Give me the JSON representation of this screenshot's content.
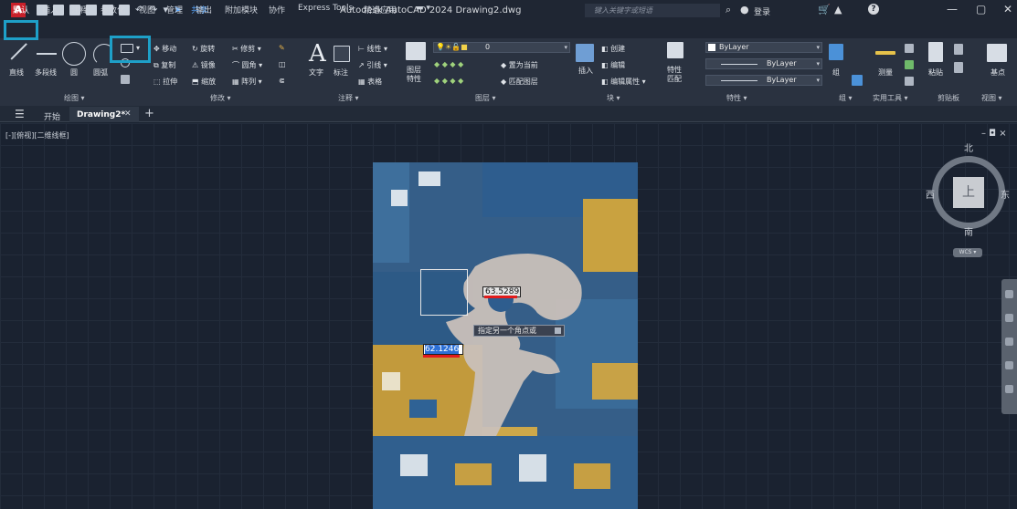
{
  "titlebar": {
    "app_logo": "A",
    "share": "共享",
    "doc_title": "Autodesk AutoCAD 2024   Drawing2.dwg",
    "search_placeholder": "键入关键字或短语",
    "login": "登录"
  },
  "menu": {
    "tabs": [
      "默认",
      "插入",
      "注释",
      "参数化",
      "视图",
      "管理",
      "输出",
      "附加模块",
      "协作",
      "Express Tools",
      "精选应用"
    ]
  },
  "ribbon": {
    "draw": {
      "line": "直线",
      "polyline": "多段线",
      "circle": "圆",
      "arc": "圆弧",
      "label": "绘图 ▾"
    },
    "modify": {
      "move": "移动",
      "rotate": "旋转",
      "trim": "修剪",
      "copy": "复制",
      "mirror": "镜像",
      "fillet": "圆角",
      "stretch": "拉伸",
      "scale": "缩放",
      "array": "阵列",
      "label": "修改 ▾"
    },
    "annotation": {
      "text": "文字",
      "dimension": "标注",
      "linear": "线性",
      "leader": "引线",
      "table": "表格",
      "label": "注释 ▾"
    },
    "layers": {
      "layer_props": "图层\n特性",
      "current_layer": "0",
      "make_current": "置为当前",
      "match_layer": "匹配图层",
      "label": "图层 ▾"
    },
    "block": {
      "insert": "插入",
      "create": "创建",
      "edit": "编辑",
      "edit_attr": "编辑属性",
      "label": "块 ▾"
    },
    "properties": {
      "match": "特性\n匹配",
      "color": "ByLayer",
      "linetype": "ByLayer",
      "lineweight": "ByLayer",
      "label": "特性 ▾"
    },
    "groups": {
      "group": "组",
      "label": "组 ▾"
    },
    "utilities": {
      "measure": "测量",
      "label": "实用工具 ▾"
    },
    "clipboard": {
      "paste": "粘贴",
      "label": "剪贴板"
    },
    "view": {
      "base": "基点",
      "label": "视图 ▾"
    }
  },
  "filetabs": {
    "start": "开始",
    "drawing": "Drawing2*"
  },
  "viewport": {
    "label": "[-][俯视][二维线框]",
    "controls": "– ◘ ×"
  },
  "dynamic_input": {
    "value1": "63.5289",
    "prompt": "指定另一个角点或",
    "value2": "62.1246"
  },
  "viewcube": {
    "north": "北",
    "south": "南",
    "west": "西",
    "east": "东",
    "top": "上",
    "wcs": "WCS ▾"
  },
  "colors": {
    "highlight": "#1ea0c8",
    "underline": "#e21b1b",
    "logo": "#c8202a"
  }
}
